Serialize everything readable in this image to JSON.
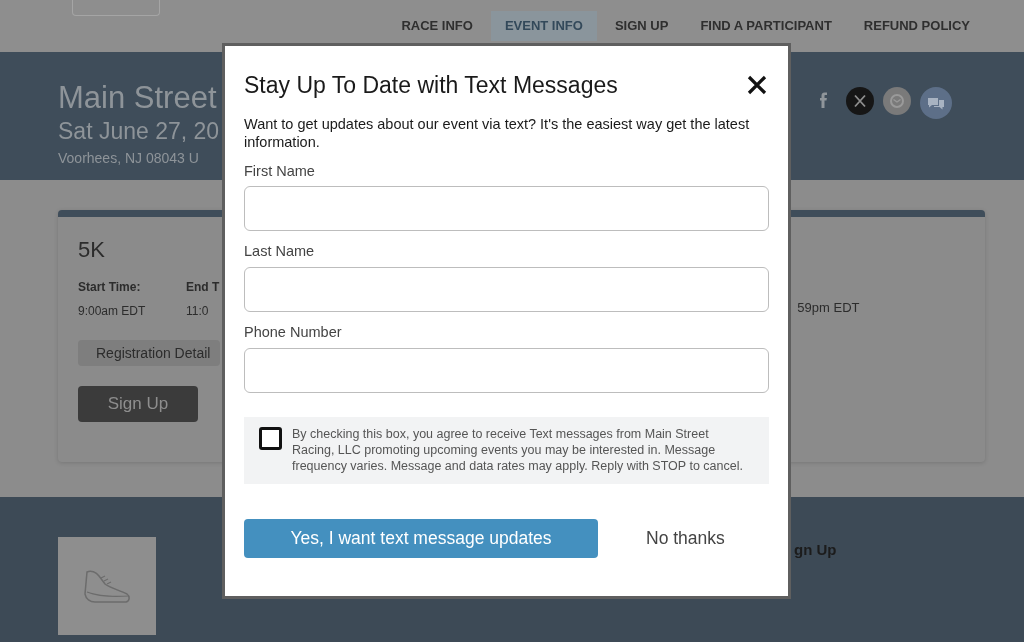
{
  "nav": {
    "items": [
      {
        "label": "RACE INFO",
        "selected": false
      },
      {
        "label": "EVENT INFO",
        "selected": true
      },
      {
        "label": "SIGN UP",
        "selected": false
      },
      {
        "label": "FIND A PARTICIPANT",
        "selected": false
      },
      {
        "label": "REFUND POLICY",
        "selected": false
      }
    ]
  },
  "event": {
    "title": "Main Street",
    "date": "Sat June 27, 20",
    "location": "Voorhees, NJ 08043 U"
  },
  "race_card": {
    "name": "5K",
    "start_label": "Start Time:",
    "start_value": "9:00am EDT",
    "column_2_label": "End T",
    "column_2_value": "11:0",
    "column_3_value": "59pm EDT",
    "details_button": "Registration Detail",
    "signup_button": "Sign Up"
  },
  "lower_section": {
    "heading": "gn Up"
  },
  "modal": {
    "title": "Stay Up To Date with Text Messages",
    "intro": "Want to get updates about our event via text? It's the easiest way get the latest information.",
    "fields": [
      {
        "label": "First Name"
      },
      {
        "label": "Last Name"
      },
      {
        "label": "Phone Number"
      }
    ],
    "consent": {
      "text": "By checking this box, you agree to receive Text messages from Main Street Racing, LLC promoting upcoming events you may be interested in. Message frequency varies. Message and data rates may apply. Reply with STOP to cancel.",
      "checked": false
    },
    "confirm_button": "Yes, I want text message updates",
    "decline_button": "No thanks"
  }
}
